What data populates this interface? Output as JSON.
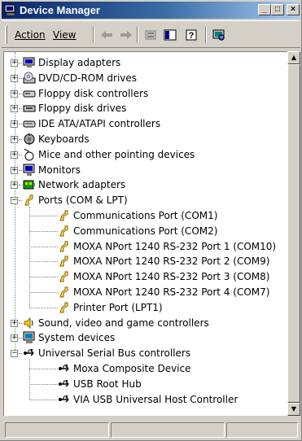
{
  "window": {
    "title": "Device Manager",
    "controls": {
      "minimize": "_",
      "maximize": "□",
      "close": "×"
    }
  },
  "menu": {
    "action": "Action",
    "view": "View"
  },
  "toolbar": {
    "icons": [
      "back-arrow-icon",
      "forward-arrow-icon",
      "properties-icon",
      "show-hide-console-tree-icon",
      "help-icon",
      "scan-hardware-icon"
    ]
  },
  "tree": {
    "categories": [
      {
        "label": "Display adapters",
        "icon": "display-adapter-icon",
        "state": "collapsed"
      },
      {
        "label": "DVD/CD-ROM drives",
        "icon": "cdrom-icon",
        "state": "collapsed"
      },
      {
        "label": "Floppy disk controllers",
        "icon": "disk-controller-icon",
        "state": "collapsed"
      },
      {
        "label": "Floppy disk drives",
        "icon": "floppy-drive-icon",
        "state": "collapsed"
      },
      {
        "label": "IDE ATA/ATAPI controllers",
        "icon": "ide-controller-icon",
        "state": "collapsed"
      },
      {
        "label": "Keyboards",
        "icon": "keyboard-icon",
        "state": "collapsed"
      },
      {
        "label": "Mice and other pointing devices",
        "icon": "mouse-icon",
        "state": "collapsed"
      },
      {
        "label": "Monitors",
        "icon": "monitor-icon",
        "state": "collapsed"
      },
      {
        "label": "Network adapters",
        "icon": "network-adapter-icon",
        "state": "collapsed"
      },
      {
        "label": "Ports (COM & LPT)",
        "icon": "port-icon",
        "state": "expanded"
      },
      {
        "label": "Sound, video and game controllers",
        "icon": "sound-icon",
        "state": "collapsed"
      },
      {
        "label": "System devices",
        "icon": "system-devices-icon",
        "state": "collapsed"
      },
      {
        "label": "Universal Serial Bus controllers",
        "icon": "usb-icon",
        "state": "expanded"
      }
    ],
    "ports": [
      "Communications Port (COM1)",
      "Communications Port (COM2)",
      "MOXA NPort 1240 RS-232 Port 1 (COM10)",
      "MOXA NPort 1240 RS-232 Port 2 (COM9)",
      "MOXA NPort 1240 RS-232 Port 3 (COM8)",
      "MOXA NPort 1240 RS-232 Port 4 (COM7)",
      "Printer Port (LPT1)"
    ],
    "usb": [
      "Moxa Composite Device",
      "USB Root Hub",
      "VIA USB Universal Host Controller"
    ]
  },
  "colors": {
    "titlebar_start": "#0a246a",
    "titlebar_end": "#a6caf0",
    "face": "#d4d0c8"
  }
}
